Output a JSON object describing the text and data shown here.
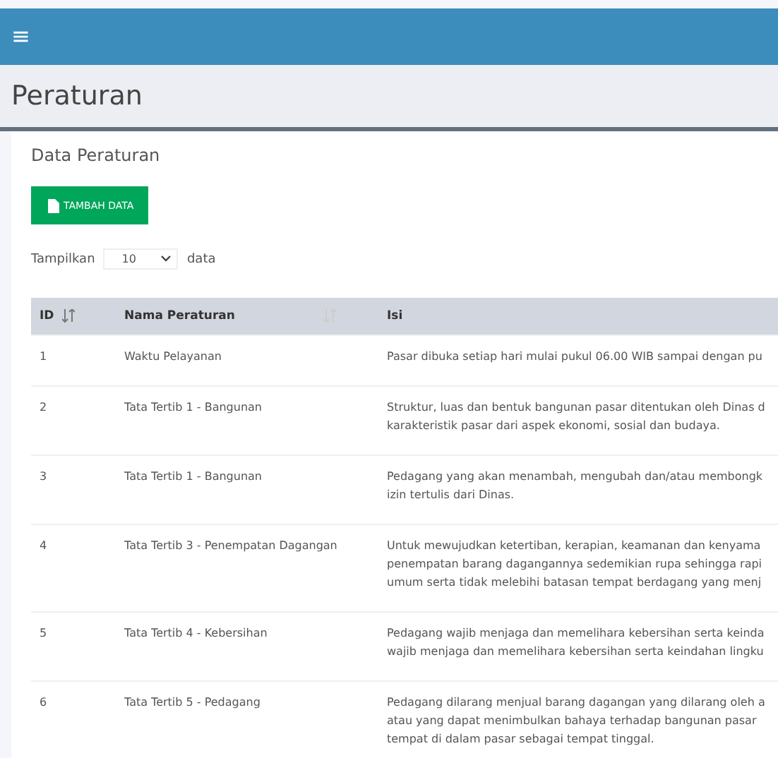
{
  "topbar": {
    "menu_icon": "≡"
  },
  "page_title": "Peraturan",
  "card": {
    "title": "Data Peraturan",
    "add_button": "TAMBAH DATA",
    "length": {
      "before": "Tampilkan",
      "value": "10",
      "after": "data"
    }
  },
  "table": {
    "columns": [
      {
        "label": "ID",
        "sortable": true
      },
      {
        "label": "Nama Peraturan",
        "sortable": true
      },
      {
        "label": "Isi",
        "sortable": false
      }
    ],
    "rows": [
      {
        "id": "1",
        "name": "Waktu Pelayanan",
        "isi": [
          "Pasar dibuka setiap hari mulai pukul 06.00 WIB sampai dengan pu"
        ]
      },
      {
        "id": "2",
        "name": "Tata Tertib 1 - Bangunan",
        "isi": [
          "Struktur, luas dan bentuk bangunan pasar ditentukan oleh Dinas d",
          "karakteristik pasar dari aspek ekonomi, sosial dan budaya."
        ]
      },
      {
        "id": "3",
        "name": "Tata Tertib 1 - Bangunan",
        "isi": [
          "Pedagang yang akan menambah, mengubah dan/atau membongk",
          "izin tertulis dari Dinas."
        ]
      },
      {
        "id": "4",
        "name": "Tata Tertib 3 - Penempatan Dagangan",
        "isi": [
          "Untuk mewujudkan ketertiban, kerapian, keamanan dan kenyama",
          "penempatan barang dagangannya sedemikian rupa sehingga rapi",
          "umum serta tidak melebihi batasan tempat berdagang yang menj"
        ]
      },
      {
        "id": "5",
        "name": "Tata Tertib 4 - Kebersihan",
        "isi": [
          "Pedagang wajib menjaga dan memelihara kebersihan serta keinda",
          "wajib menjaga dan memelihara kebersihan serta keindahan lingku"
        ]
      },
      {
        "id": "6",
        "name": "Tata Tertib 5 - Pedagang",
        "isi": [
          "Pedagang dilarang menjual barang dagangan yang dilarang oleh a",
          "atau yang dapat menimbulkan bahaya terhadap bangunan pasar",
          "tempat di dalam pasar sebagai tempat tinggal."
        ]
      }
    ]
  }
}
